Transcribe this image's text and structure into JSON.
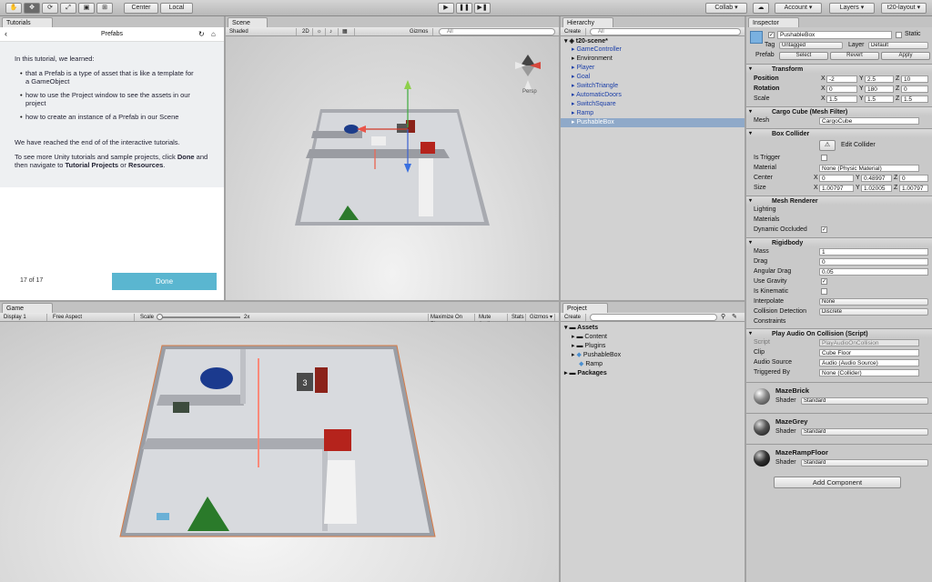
{
  "toolbar": {
    "center": "Center",
    "local": "Local",
    "collab": "Collab ▾",
    "account": "Account ▾",
    "layers": "Layers ▾",
    "layout": "t20-layout ▾",
    "tools": [
      "hand-tool",
      "move-tool",
      "rotate-tool",
      "scale-tool",
      "rect-tool",
      "transform-tool"
    ],
    "play": "▶",
    "pause": "❚❚",
    "step": "▶❚"
  },
  "tutorial": {
    "tab": "Tutorials",
    "title": "Prefabs",
    "intro": "In this tutorial, we learned:",
    "bullets": [
      "that a Prefab is a type of asset that is like a template for a GameObject",
      "how to use the Project window to see the assets in our project",
      "how to create an instance of a Prefab in our Scene"
    ],
    "end": "We have reached the end of of the interactive tutorials.",
    "more1": "To see more Unity tutorials and sample projects, click ",
    "more_done": "Done",
    "more2": " and then navigate to ",
    "more_tp": "Tutorial Projects",
    "more_or": " or ",
    "more_res": "Resources",
    "more_end": ".",
    "page": "17 of 17",
    "done": "Done"
  },
  "scene": {
    "tab": "Scene",
    "shading": "Shaded",
    "mode2d": "2D",
    "gizmos": "Gizmos ▾",
    "search": "All",
    "persp": "Persp"
  },
  "game": {
    "tab": "Game",
    "display": "Display 1",
    "aspect": "Free Aspect",
    "scale_label": "Scale",
    "scale_val": "2x",
    "maximize": "Maximize On Play",
    "mute": "Mute Audio",
    "stats": "Stats",
    "gizmos": "Gizmos ▾"
  },
  "hierarchy": {
    "tab": "Hierarchy",
    "create": "Create ▾",
    "search": "All",
    "scene": "t20-scene*",
    "items": [
      "GameController",
      "Environment",
      "Player",
      "Goal",
      "SwitchTriangle",
      "AutomaticDoors",
      "SwitchSquare",
      "Ramp",
      "PushableBox"
    ]
  },
  "project": {
    "tab": "Project",
    "create": "Create ▾",
    "assets": "Assets",
    "items": [
      "Content",
      "Plugins",
      "PushableBox",
      "Ramp"
    ],
    "packages": "Packages"
  },
  "inspector": {
    "tab": "Inspector",
    "name": "PushableBox",
    "static": "Static",
    "tag_label": "Tag",
    "tag": "Untagged",
    "layer_label": "Layer",
    "layer": "Default",
    "prefab_label": "Prefab",
    "select": "Select",
    "revert": "Revert",
    "apply": "Apply",
    "transform": {
      "title": "Transform",
      "position": "Position",
      "rotation": "Rotation",
      "scale": "Scale",
      "pos": [
        "-2",
        "2.5",
        "10"
      ],
      "rot": [
        "0",
        "180",
        "0"
      ],
      "scl": [
        "1.5",
        "1.5",
        "1.5"
      ]
    },
    "meshfilter": {
      "title": "Cargo Cube (Mesh Filter)",
      "mesh_label": "Mesh",
      "mesh": "CargoCube"
    },
    "boxcollider": {
      "title": "Box Collider",
      "edit": "Edit Collider",
      "trigger": "Is Trigger",
      "material_label": "Material",
      "material": "None (Physic Material)",
      "center_label": "Center",
      "center": [
        "0",
        "0.48997",
        "0"
      ],
      "size_label": "Size",
      "size": [
        "1.00797",
        "1.02005",
        "1.00797"
      ]
    },
    "meshrenderer": {
      "title": "Mesh Renderer",
      "lighting": "Lighting",
      "materials": "Materials",
      "occluded": "Dynamic Occluded"
    },
    "rigidbody": {
      "title": "Rigidbody",
      "mass_label": "Mass",
      "mass": "1",
      "drag_label": "Drag",
      "drag": "0",
      "adrag_label": "Angular Drag",
      "adrag": "0.05",
      "gravity": "Use Gravity",
      "kinematic": "Is Kinematic",
      "interp_label": "Interpolate",
      "interp": "None",
      "coll_label": "Collision Detection",
      "coll": "Discrete",
      "constraints": "Constraints"
    },
    "playaudio": {
      "title": "Play Audio On Collision (Script)",
      "script_label": "Script",
      "script": "PlayAudioOnCollision",
      "clip_label": "Clip",
      "clip": "Cube Floor",
      "src_label": "Audio Source",
      "src": "Audio (Audio Source)",
      "trig_label": "Triggered By",
      "trig": "None (Collider)"
    },
    "materials_list": [
      {
        "name": "MazeBrick",
        "shader": "Standard"
      },
      {
        "name": "MazeGrey",
        "shader": "Standard"
      },
      {
        "name": "MazeRampFloor",
        "shader": "Standard"
      }
    ],
    "shader_label": "Shader",
    "add": "Add Component"
  }
}
